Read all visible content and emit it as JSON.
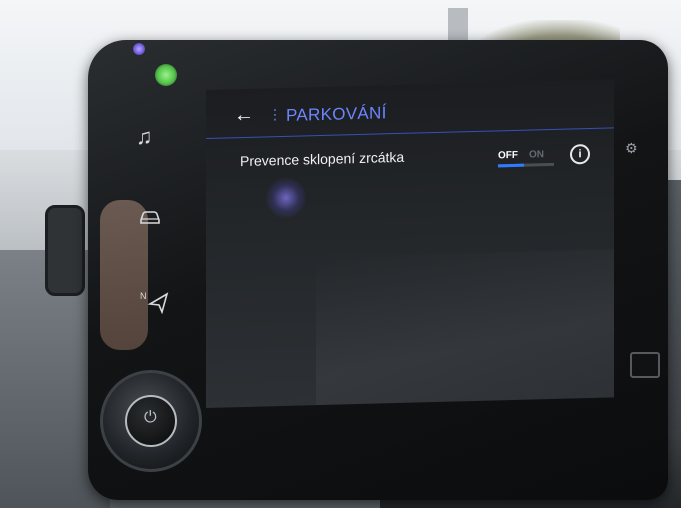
{
  "header": {
    "back_icon": "arrow-left-icon",
    "menu_icon": "vertical-dots-icon",
    "title": "PARKOVÁNÍ"
  },
  "settings": [
    {
      "label": "Prevence sklopení zrcátka",
      "toggle": {
        "off_label": "OFF",
        "on_label": "ON",
        "state": "OFF"
      },
      "info_icon": "info-icon"
    }
  ],
  "side_buttons": [
    {
      "icon": "music-note-icon"
    },
    {
      "icon": "car-icon"
    },
    {
      "icon": "navigation-icon"
    }
  ],
  "colors": {
    "accent": "#6c86ff",
    "toggle_active": "#2f7bff",
    "screen_bg": "#1b1d20"
  }
}
